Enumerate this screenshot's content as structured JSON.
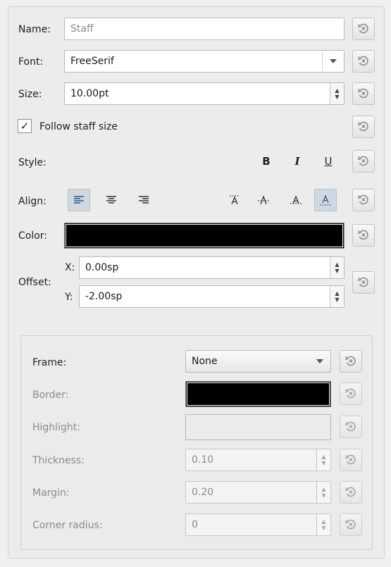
{
  "fields": {
    "name": {
      "label": "Name:",
      "value": "Staff"
    },
    "font": {
      "label": "Font:",
      "value": "FreeSerif"
    },
    "size": {
      "label": "Size:",
      "value": "10.00pt"
    },
    "follow_staff_size": {
      "label": "Follow staff size",
      "checked": true
    },
    "style": {
      "label": "Style:",
      "bold": "B",
      "italic": "I",
      "underline": "U"
    },
    "align": {
      "label": "Align:"
    },
    "color": {
      "label": "Color:",
      "value": "#000000"
    },
    "offset": {
      "label": "Offset:",
      "x_label": "X:",
      "x_value": "0.00sp",
      "y_label": "Y:",
      "y_value": "-2.00sp"
    }
  },
  "frame_section": {
    "frame": {
      "label": "Frame:",
      "value": "None"
    },
    "border": {
      "label": "Border:",
      "color": "#000000"
    },
    "highlight": {
      "label": "Highlight:"
    },
    "thickness": {
      "label": "Thickness:",
      "value": "0.10"
    },
    "margin": {
      "label": "Margin:",
      "value": "0.20"
    },
    "corner_radius": {
      "label": "Corner radius:",
      "value": "0"
    }
  },
  "icons": {
    "reset": "reset-to-default-icon",
    "align_left": "align-left-icon",
    "align_center": "align-center-icon",
    "align_right": "align-right-icon",
    "valign_top": "align-top-icon",
    "valign_vcenter": "align-vcenter-icon",
    "valign_baseline": "align-baseline-icon",
    "valign_bottom": "align-bottom-icon"
  }
}
